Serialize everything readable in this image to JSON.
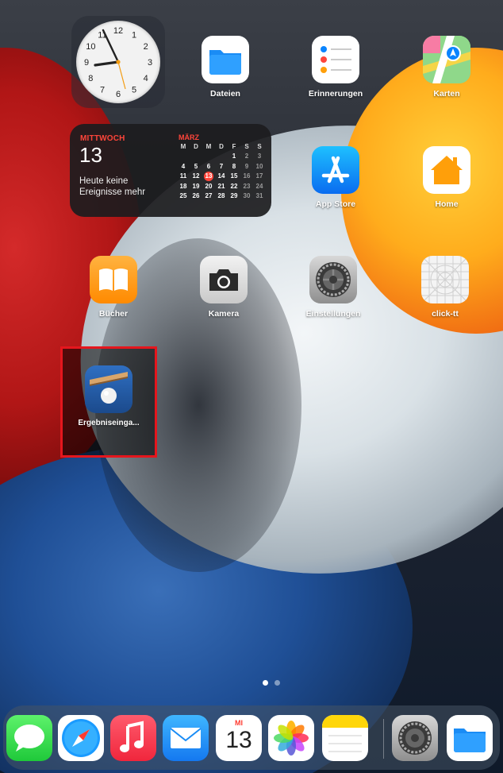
{
  "clock": {
    "numbers": [
      "12",
      "1",
      "2",
      "3",
      "4",
      "5",
      "6",
      "7",
      "8",
      "9",
      "10",
      "11"
    ]
  },
  "calendar": {
    "weekday": "MITTWOCH",
    "date": "13",
    "no_events": "Heute keine Ereignisse mehr",
    "month": "MÄRZ",
    "day_headers": [
      "M",
      "D",
      "M",
      "D",
      "F",
      "S",
      "S"
    ],
    "weeks": [
      [
        "",
        "",
        "",
        "",
        "1",
        "2",
        "3"
      ],
      [
        "4",
        "5",
        "6",
        "7",
        "8",
        "9",
        "10"
      ],
      [
        "11",
        "12",
        "13",
        "14",
        "15",
        "16",
        "17"
      ],
      [
        "18",
        "19",
        "20",
        "21",
        "22",
        "23",
        "24"
      ],
      [
        "25",
        "26",
        "27",
        "28",
        "29",
        "30",
        "31"
      ]
    ],
    "today": "13"
  },
  "apps": {
    "dateien": "Dateien",
    "erinnerungen": "Erinnerungen",
    "karten": "Karten",
    "app_store": "App Store",
    "home": "Home",
    "buecher": "Bücher",
    "kamera": "Kamera",
    "einstellungen": "Einstellungen",
    "click_tt": "click-tt",
    "ergebniseingabe": "Ergebniseinga..."
  },
  "dock": {
    "calendar_weekday": "MI",
    "calendar_date": "13",
    "apps": [
      "messages-icon",
      "safari-icon",
      "music-icon",
      "mail-icon",
      "calendar-icon",
      "photos-icon",
      "notes-icon",
      "settings-icon",
      "files-icon"
    ]
  },
  "page_indicator": {
    "current": 1,
    "total": 2
  },
  "colors": {
    "highlight": "#e5161d",
    "calendar_accent": "#ff453a"
  }
}
